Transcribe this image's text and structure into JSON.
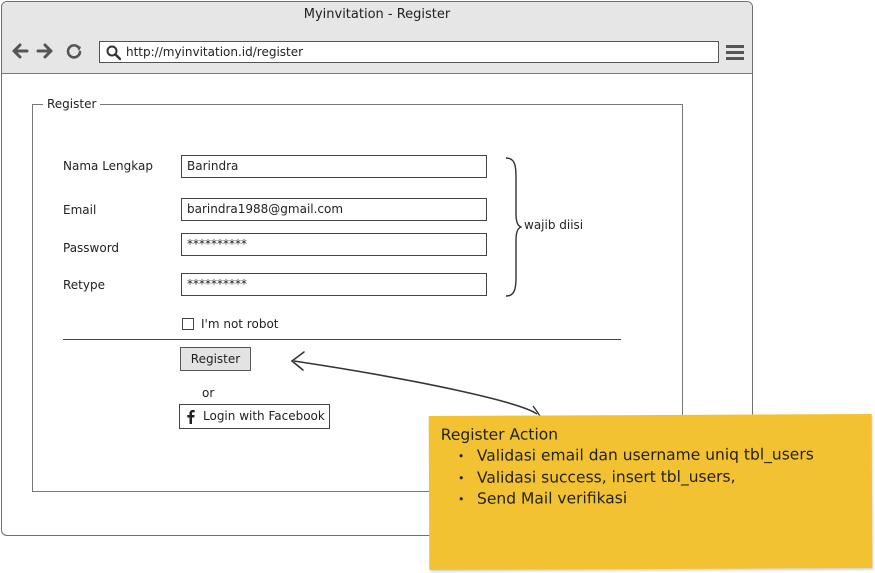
{
  "window": {
    "title": "Myinvitation - Register"
  },
  "browser": {
    "url": "http://myinvitation.id/register"
  },
  "form": {
    "legend": "Register",
    "fields": [
      {
        "label": "Nama Lengkap",
        "value": "Barindra"
      },
      {
        "label": "Email",
        "value": "barindra1988@gmail.com"
      },
      {
        "label": "Password",
        "value": "**********"
      },
      {
        "label": "Retype",
        "value": "**********"
      }
    ],
    "captcha_label": "I'm not robot",
    "captcha_checked": false,
    "register_label": "Register",
    "or_text": "or",
    "facebook_label": "Login with Facebook"
  },
  "annotation": {
    "required_note": "wajib diisi"
  },
  "sticky_note": {
    "title": "Register Action",
    "items": [
      "Validasi email dan username uniq tbl_users",
      "Validasi success, insert tbl_users,",
      "Send Mail verifikasi"
    ],
    "color": "#f2c233"
  },
  "icons": [
    "back-arrow-icon",
    "forward-arrow-icon",
    "reload-icon",
    "search-icon",
    "hamburger-menu-icon",
    "facebook-icon"
  ]
}
